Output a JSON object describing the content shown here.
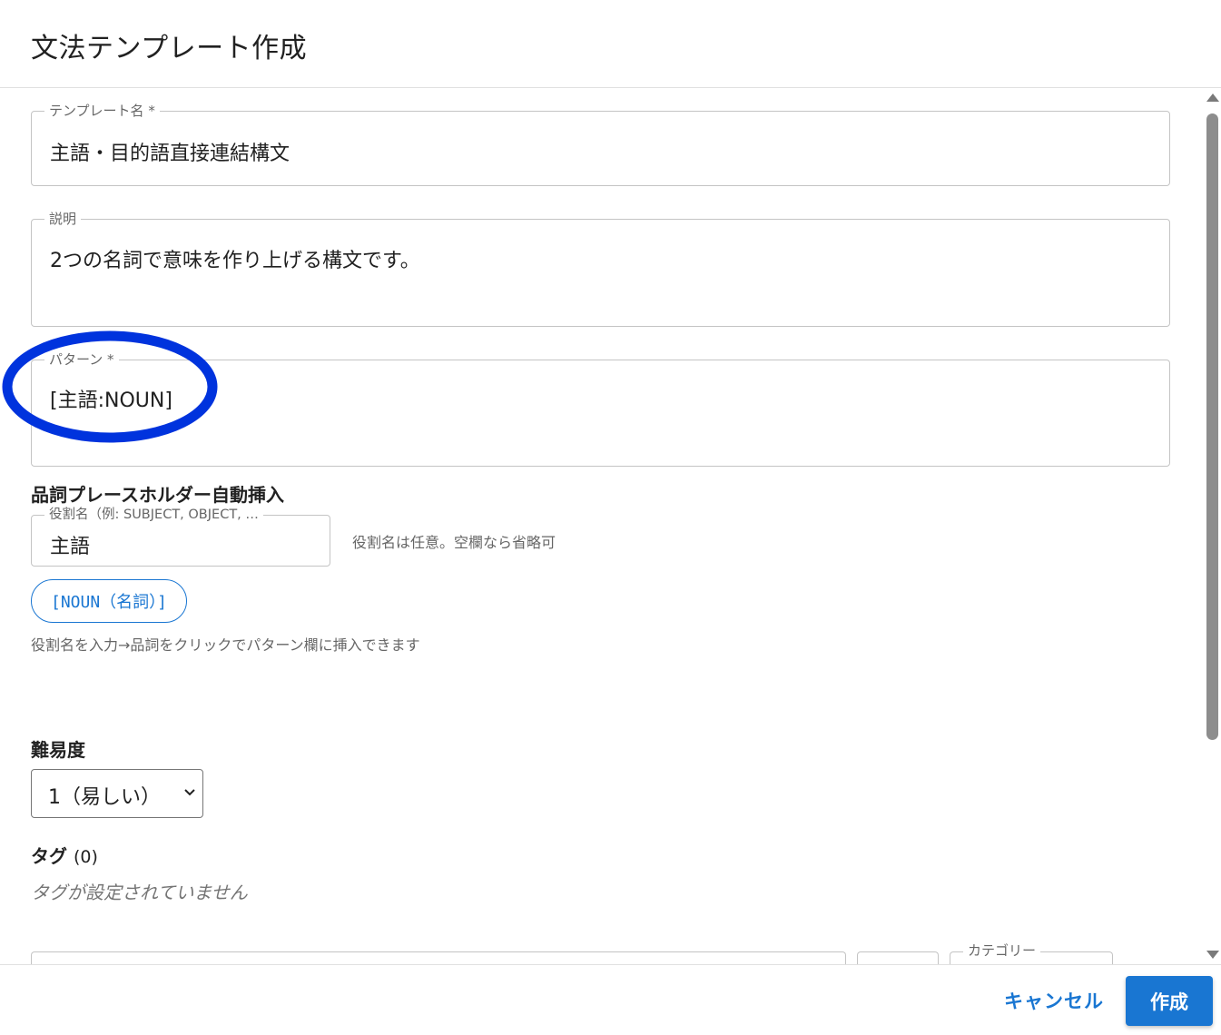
{
  "dialog": {
    "title": "文法テンプレート作成"
  },
  "form": {
    "template_name": {
      "label": "テンプレート名 *",
      "value": "主語・目的語直接連結構文"
    },
    "description": {
      "label": "説明",
      "value": "2つの名詞で意味を作り上げる構文です。"
    },
    "pattern": {
      "label": "パターン *",
      "value": "[主語:NOUN]"
    },
    "pos_insert": {
      "heading": "品詞プレースホルダー自動挿入",
      "role_label": "役割名（例: SUBJECT, OBJECT, …",
      "role_value": "主語",
      "role_hint": "役割名は任意。空欄なら省略可",
      "chip_label": "[NOUN（名詞）]",
      "helper": "役割名を入力→品詞をクリックでパターン欄に挿入できます"
    },
    "difficulty": {
      "heading": "難易度",
      "selected": "1（易しい）"
    },
    "tags": {
      "heading": "タグ",
      "count": "(0)",
      "empty_text": "タグが設定されていません"
    },
    "category": {
      "label": "カテゴリー"
    }
  },
  "footer": {
    "cancel_label": "キャンセル",
    "create_label": "作成"
  },
  "colors": {
    "accent": "#1976d2",
    "annotation": "#0033dd"
  }
}
